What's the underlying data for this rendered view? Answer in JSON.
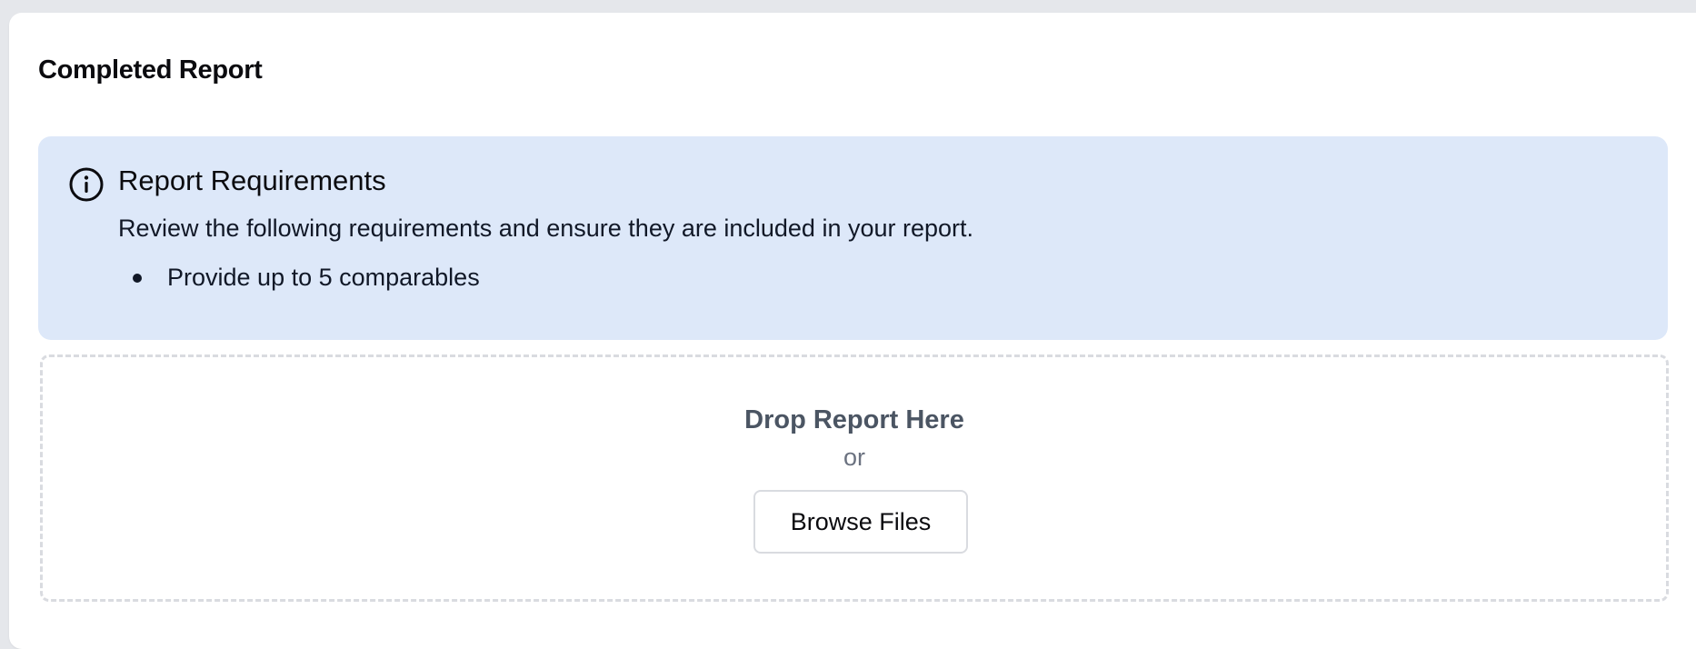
{
  "section": {
    "title": "Completed Report"
  },
  "requirements": {
    "icon": "info-circle-icon",
    "title": "Report Requirements",
    "description": "Review the following requirements and ensure they are included in your report.",
    "items": [
      {
        "label": "Provide up to 5 comparables"
      }
    ],
    "background_color": "#dde8f9"
  },
  "upload": {
    "drop_label": "Drop Report Here",
    "or_label": "or",
    "browse_label": "Browse Files"
  }
}
